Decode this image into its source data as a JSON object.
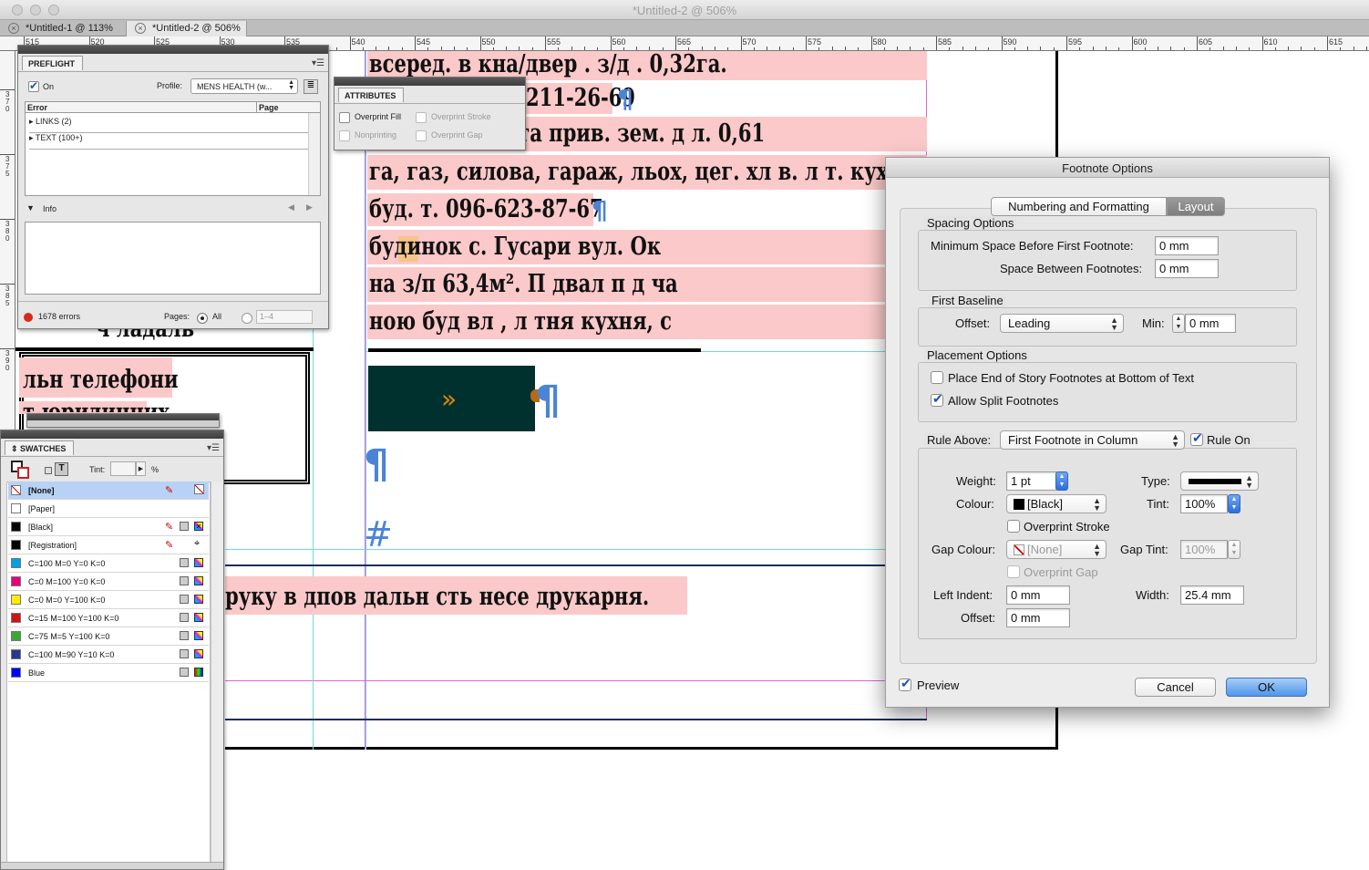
{
  "window": {
    "title": "*Untitled-2 @ 506%"
  },
  "doc_tabs": [
    {
      "label": "*Untitled-1 @ 113%",
      "active": false
    },
    {
      "label": "*Untitled-2 @ 506%",
      "active": true
    }
  ],
  "ruler": {
    "h_labels": [
      "515",
      "520",
      "525",
      "530",
      "535",
      "540",
      "545",
      "550",
      "555",
      "560",
      "565",
      "570",
      "575",
      "580",
      "585",
      "590",
      "595",
      "600",
      "605",
      "610",
      "615"
    ],
    "v_labels": [
      "370",
      "375",
      "380",
      "385",
      "390"
    ]
  },
  "document": {
    "lines": [
      "всеред.  в  кна/двер  .  з/д  .  0,32га.",
      "211-26-69",
      "с. Гоноратка та прив. зем. д  л. 0,61",
      "га, газ, силова, гараж, льох, цег. хл  в. л  т. кух.,",
      "буд. т. 096-623-87-67",
      "будинок  с.  Гусари  вул.  Ок",
      "на  з/п  63,4м².  П  двал  п  д  ча",
      "ною  буд  вл  ,  л  тня  кухня,  с",
      "руку в  дпов  дальн  сть несе друкарня."
    ],
    "left_fragments": [
      "ч ладаль",
      "льн  телефони",
      "т  юридичних"
    ],
    "pilcrow": "¶",
    "hash": "#",
    "chevrons": "»"
  },
  "preflight": {
    "tab": "PREFLIGHT",
    "on_label": "On",
    "on_checked": true,
    "profile_label": "Profile:",
    "profile_value": "MENS HEALTH (w...",
    "col_error": "Error",
    "col_page": "Page",
    "rows": [
      "LINKS (2)",
      "TEXT (100+)"
    ],
    "info_label": "Info",
    "errors": "1678 errors",
    "pages_label": "Pages:",
    "pages_all": "All",
    "pages_range": "1–4",
    "status_color": "#d62a1c"
  },
  "attributes": {
    "tab": "ATTRIBUTES",
    "overprint_fill": "Overprint Fill",
    "overprint_stroke": "Overprint Stroke",
    "nonprinting": "Nonprinting",
    "overprint_gap": "Overprint Gap"
  },
  "swatches": {
    "tab": "SWATCHES",
    "tint_label": "Tint:",
    "tint_unit": "%",
    "items": [
      {
        "name": "[None]",
        "color": "none",
        "selected": true
      },
      {
        "name": "[Paper]",
        "color": "#ffffff"
      },
      {
        "name": "[Black]",
        "color": "#000000"
      },
      {
        "name": "[Registration]",
        "color": "#000000"
      },
      {
        "name": "C=100 M=0 Y=0 K=0",
        "color": "#00a0e3"
      },
      {
        "name": "C=0 M=100 Y=0 K=0",
        "color": "#e5007e"
      },
      {
        "name": "C=0 M=0 Y=100 K=0",
        "color": "#ffed00"
      },
      {
        "name": "C=15 M=100 Y=100 K=0",
        "color": "#c8161d"
      },
      {
        "name": "C=75 M=5 Y=100 K=0",
        "color": "#38a935"
      },
      {
        "name": "C=100 M=90 Y=10 K=0",
        "color": "#233b8d"
      },
      {
        "name": "Blue",
        "color": "#0000ff"
      }
    ]
  },
  "footnote_dialog": {
    "title": "Footnote Options",
    "tabs": [
      "Numbering and Formatting",
      "Layout"
    ],
    "active_tab": "Layout",
    "spacing": {
      "group": "Spacing Options",
      "min_space_label": "Minimum Space Before First Footnote:",
      "min_space_value": "0 mm",
      "between_label": "Space Between Footnotes:",
      "between_value": "0 mm"
    },
    "baseline": {
      "group": "First Baseline",
      "offset_label": "Offset:",
      "offset_value": "Leading",
      "min_label": "Min:",
      "min_value": "0 mm"
    },
    "placement": {
      "group": "Placement Options",
      "end_of_story": "Place End of Story Footnotes at Bottom of Text",
      "end_of_story_checked": false,
      "allow_split": "Allow Split Footnotes",
      "allow_split_checked": true
    },
    "rule": {
      "rule_above_label": "Rule Above:",
      "rule_above_value": "First Footnote in Column",
      "rule_on_label": "Rule On",
      "rule_on_checked": true,
      "weight_label": "Weight:",
      "weight_value": "1 pt",
      "type_label": "Type:",
      "colour_label": "Colour:",
      "colour_value": "[Black]",
      "tint_label": "Tint:",
      "tint_value": "100%",
      "overprint_stroke": "Overprint Stroke",
      "gap_colour_label": "Gap Colour:",
      "gap_colour_value": "[None]",
      "gap_tint_label": "Gap Tint:",
      "gap_tint_value": "100%",
      "overprint_gap": "Overprint Gap",
      "left_indent_label": "Left Indent:",
      "left_indent_value": "0 mm",
      "width_label": "Width:",
      "width_value": "25.4 mm",
      "offset_label": "Offset:",
      "offset_value": "0 mm"
    },
    "preview_label": "Preview",
    "preview_checked": true,
    "cancel": "Cancel",
    "ok": "OK"
  },
  "colors": {
    "highlight": "#fbc9c9",
    "guide_cyan": "#6fdcdc",
    "guide_magenta": "#d46bd4",
    "anchor_box": "#01312f",
    "accent_blue": "#4f95ec"
  }
}
